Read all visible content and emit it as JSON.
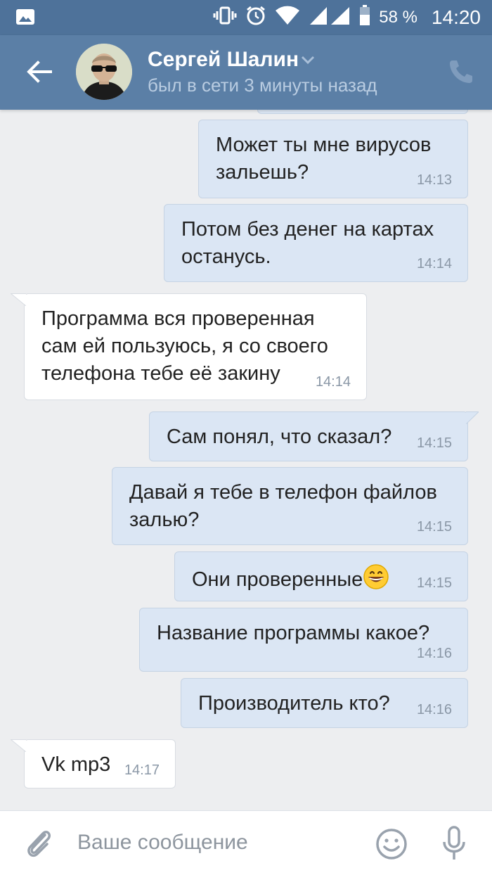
{
  "statusbar": {
    "battery_pct": "58 %",
    "time": "14:20"
  },
  "header": {
    "contact_name": "Сергей Шалин",
    "contact_status": "был в сети 3 минуты назад"
  },
  "messages": [
    {
      "direction": "out",
      "lines": [
        "Может ты мне вирусов",
        "зальешь?"
      ],
      "time": "14:13"
    },
    {
      "direction": "out",
      "lines": [
        "Потом без денег на картах",
        "останусь."
      ],
      "time": "14:14"
    },
    {
      "direction": "in",
      "lines": [
        "Программа вся проверенная",
        "сам ей пользуюсь, я со своего",
        "телефона тебе её закину"
      ],
      "time": "14:14"
    },
    {
      "direction": "out",
      "lines": [
        "Сам понял, что сказал?"
      ],
      "time": "14:15"
    },
    {
      "direction": "out",
      "lines": [
        "Давай я тебе в телефон файлов",
        "залью?"
      ],
      "time": "14:15"
    },
    {
      "direction": "out",
      "lines": [
        "Они проверенные"
      ],
      "emoji": "grinning-face",
      "time": "14:15"
    },
    {
      "direction": "out",
      "lines": [
        "Название программы какое?"
      ],
      "time": "14:16"
    },
    {
      "direction": "out",
      "lines": [
        "Производитель кто?"
      ],
      "time": "14:16"
    },
    {
      "direction": "in",
      "lines": [
        "Vk mp3"
      ],
      "time": "14:17"
    }
  ],
  "composer": {
    "placeholder": "Ваше сообщение"
  },
  "colors": {
    "header_bg": "#5b7fa6",
    "statusbar_bg": "#4e729a",
    "chat_bg": "#edeef0",
    "outgoing_bubble": "#dbe6f4",
    "incoming_bubble": "#ffffff"
  }
}
